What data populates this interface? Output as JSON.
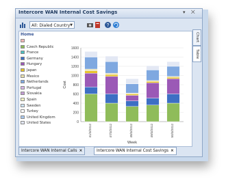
{
  "window": {
    "title": "Intercore WAN Internal Cost Savings",
    "pin": "▾ ⨉"
  },
  "toolbar": {
    "dropdown_value": "All: Dialed Country",
    "icons": [
      "chart-icon",
      "camera-icon",
      "export-icon",
      "help-icon",
      "refresh-icon"
    ]
  },
  "legend": {
    "title": "Home",
    "items": [
      {
        "label": "",
        "color": "#f4b6b6"
      },
      {
        "label": "Czech Republic",
        "color": "#8fbc5a"
      },
      {
        "label": "France",
        "color": "#4dbfbf"
      },
      {
        "label": "Germany",
        "color": "#3d6fc4"
      },
      {
        "label": "Hungary",
        "color": "#9b59b6"
      },
      {
        "label": "Japan",
        "color": "#e6c229"
      },
      {
        "label": "Mexico",
        "color": "#e8e0b0"
      },
      {
        "label": "Netherlands",
        "color": "#7fa8e0"
      },
      {
        "label": "Portugal",
        "color": "#d9b6e8"
      },
      {
        "label": "Slovakia",
        "color": "#c39bd3"
      },
      {
        "label": "Spain",
        "color": "#f7f7c4"
      },
      {
        "label": "Sweden",
        "color": "#cfe6f7"
      },
      {
        "label": "Turkey",
        "color": "#ffffff"
      },
      {
        "label": "United Kingdom",
        "color": "#a9c7ee"
      },
      {
        "label": "United States",
        "color": "#e3e8f4"
      }
    ]
  },
  "side_tabs": [
    "Chart",
    "Table"
  ],
  "bottom_tabs": [
    {
      "label": "Intercore WAN Internal Calls",
      "close": "×"
    },
    {
      "label": "Intercore WAN Internal Cost Savings",
      "close": "×"
    }
  ],
  "chart_data": {
    "type": "bar",
    "stacked": true,
    "title": "",
    "xlabel": "Week",
    "ylabel": "Cost",
    "ylim": [
      0,
      1600
    ],
    "yticks": [
      0,
      200,
      400,
      600,
      800,
      1000,
      1200,
      1400,
      1600
    ],
    "categories": [
      "41/3/2012",
      "47/3/2012",
      "48/3/2012",
      "49/3/2012",
      "50/3/2012"
    ],
    "series": [
      {
        "name": "Czech Republic",
        "color": "#8fbc5a",
        "values": [
          600,
          400,
          330,
          360,
          400
        ]
      },
      {
        "name": "Germany",
        "color": "#3d6fc4",
        "values": [
          150,
          200,
          120,
          150,
          200
        ]
      },
      {
        "name": "Hungary",
        "color": "#9b59b6",
        "values": [
          300,
          380,
          120,
          330,
          330
        ]
      },
      {
        "name": "Japan",
        "color": "#e6c229",
        "values": [
          50,
          40,
          30,
          30,
          30
        ]
      },
      {
        "name": "Mexico",
        "color": "#e8e0b0",
        "values": [
          40,
          30,
          20,
          20,
          20
        ]
      },
      {
        "name": "Netherlands",
        "color": "#7fa8e0",
        "values": [
          260,
          250,
          200,
          230,
          220
        ]
      },
      {
        "name": "United States",
        "color": "#e3e8f4",
        "values": [
          120,
          120,
          110,
          90,
          100
        ]
      }
    ]
  }
}
